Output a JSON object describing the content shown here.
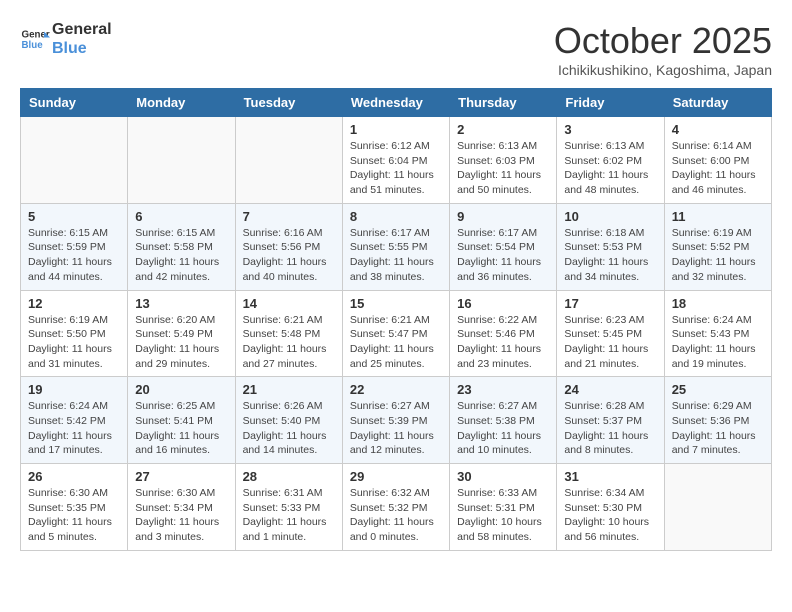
{
  "header": {
    "logo_line1": "General",
    "logo_line2": "Blue",
    "month": "October 2025",
    "location": "Ichikikushikino, Kagoshima, Japan"
  },
  "days_of_week": [
    "Sunday",
    "Monday",
    "Tuesday",
    "Wednesday",
    "Thursday",
    "Friday",
    "Saturday"
  ],
  "weeks": [
    [
      {
        "day": "",
        "info": ""
      },
      {
        "day": "",
        "info": ""
      },
      {
        "day": "",
        "info": ""
      },
      {
        "day": "1",
        "info": "Sunrise: 6:12 AM\nSunset: 6:04 PM\nDaylight: 11 hours and 51 minutes."
      },
      {
        "day": "2",
        "info": "Sunrise: 6:13 AM\nSunset: 6:03 PM\nDaylight: 11 hours and 50 minutes."
      },
      {
        "day": "3",
        "info": "Sunrise: 6:13 AM\nSunset: 6:02 PM\nDaylight: 11 hours and 48 minutes."
      },
      {
        "day": "4",
        "info": "Sunrise: 6:14 AM\nSunset: 6:00 PM\nDaylight: 11 hours and 46 minutes."
      }
    ],
    [
      {
        "day": "5",
        "info": "Sunrise: 6:15 AM\nSunset: 5:59 PM\nDaylight: 11 hours and 44 minutes."
      },
      {
        "day": "6",
        "info": "Sunrise: 6:15 AM\nSunset: 5:58 PM\nDaylight: 11 hours and 42 minutes."
      },
      {
        "day": "7",
        "info": "Sunrise: 6:16 AM\nSunset: 5:56 PM\nDaylight: 11 hours and 40 minutes."
      },
      {
        "day": "8",
        "info": "Sunrise: 6:17 AM\nSunset: 5:55 PM\nDaylight: 11 hours and 38 minutes."
      },
      {
        "day": "9",
        "info": "Sunrise: 6:17 AM\nSunset: 5:54 PM\nDaylight: 11 hours and 36 minutes."
      },
      {
        "day": "10",
        "info": "Sunrise: 6:18 AM\nSunset: 5:53 PM\nDaylight: 11 hours and 34 minutes."
      },
      {
        "day": "11",
        "info": "Sunrise: 6:19 AM\nSunset: 5:52 PM\nDaylight: 11 hours and 32 minutes."
      }
    ],
    [
      {
        "day": "12",
        "info": "Sunrise: 6:19 AM\nSunset: 5:50 PM\nDaylight: 11 hours and 31 minutes."
      },
      {
        "day": "13",
        "info": "Sunrise: 6:20 AM\nSunset: 5:49 PM\nDaylight: 11 hours and 29 minutes."
      },
      {
        "day": "14",
        "info": "Sunrise: 6:21 AM\nSunset: 5:48 PM\nDaylight: 11 hours and 27 minutes."
      },
      {
        "day": "15",
        "info": "Sunrise: 6:21 AM\nSunset: 5:47 PM\nDaylight: 11 hours and 25 minutes."
      },
      {
        "day": "16",
        "info": "Sunrise: 6:22 AM\nSunset: 5:46 PM\nDaylight: 11 hours and 23 minutes."
      },
      {
        "day": "17",
        "info": "Sunrise: 6:23 AM\nSunset: 5:45 PM\nDaylight: 11 hours and 21 minutes."
      },
      {
        "day": "18",
        "info": "Sunrise: 6:24 AM\nSunset: 5:43 PM\nDaylight: 11 hours and 19 minutes."
      }
    ],
    [
      {
        "day": "19",
        "info": "Sunrise: 6:24 AM\nSunset: 5:42 PM\nDaylight: 11 hours and 17 minutes."
      },
      {
        "day": "20",
        "info": "Sunrise: 6:25 AM\nSunset: 5:41 PM\nDaylight: 11 hours and 16 minutes."
      },
      {
        "day": "21",
        "info": "Sunrise: 6:26 AM\nSunset: 5:40 PM\nDaylight: 11 hours and 14 minutes."
      },
      {
        "day": "22",
        "info": "Sunrise: 6:27 AM\nSunset: 5:39 PM\nDaylight: 11 hours and 12 minutes."
      },
      {
        "day": "23",
        "info": "Sunrise: 6:27 AM\nSunset: 5:38 PM\nDaylight: 11 hours and 10 minutes."
      },
      {
        "day": "24",
        "info": "Sunrise: 6:28 AM\nSunset: 5:37 PM\nDaylight: 11 hours and 8 minutes."
      },
      {
        "day": "25",
        "info": "Sunrise: 6:29 AM\nSunset: 5:36 PM\nDaylight: 11 hours and 7 minutes."
      }
    ],
    [
      {
        "day": "26",
        "info": "Sunrise: 6:30 AM\nSunset: 5:35 PM\nDaylight: 11 hours and 5 minutes."
      },
      {
        "day": "27",
        "info": "Sunrise: 6:30 AM\nSunset: 5:34 PM\nDaylight: 11 hours and 3 minutes."
      },
      {
        "day": "28",
        "info": "Sunrise: 6:31 AM\nSunset: 5:33 PM\nDaylight: 11 hours and 1 minute."
      },
      {
        "day": "29",
        "info": "Sunrise: 6:32 AM\nSunset: 5:32 PM\nDaylight: 11 hours and 0 minutes."
      },
      {
        "day": "30",
        "info": "Sunrise: 6:33 AM\nSunset: 5:31 PM\nDaylight: 10 hours and 58 minutes."
      },
      {
        "day": "31",
        "info": "Sunrise: 6:34 AM\nSunset: 5:30 PM\nDaylight: 10 hours and 56 minutes."
      },
      {
        "day": "",
        "info": ""
      }
    ]
  ]
}
